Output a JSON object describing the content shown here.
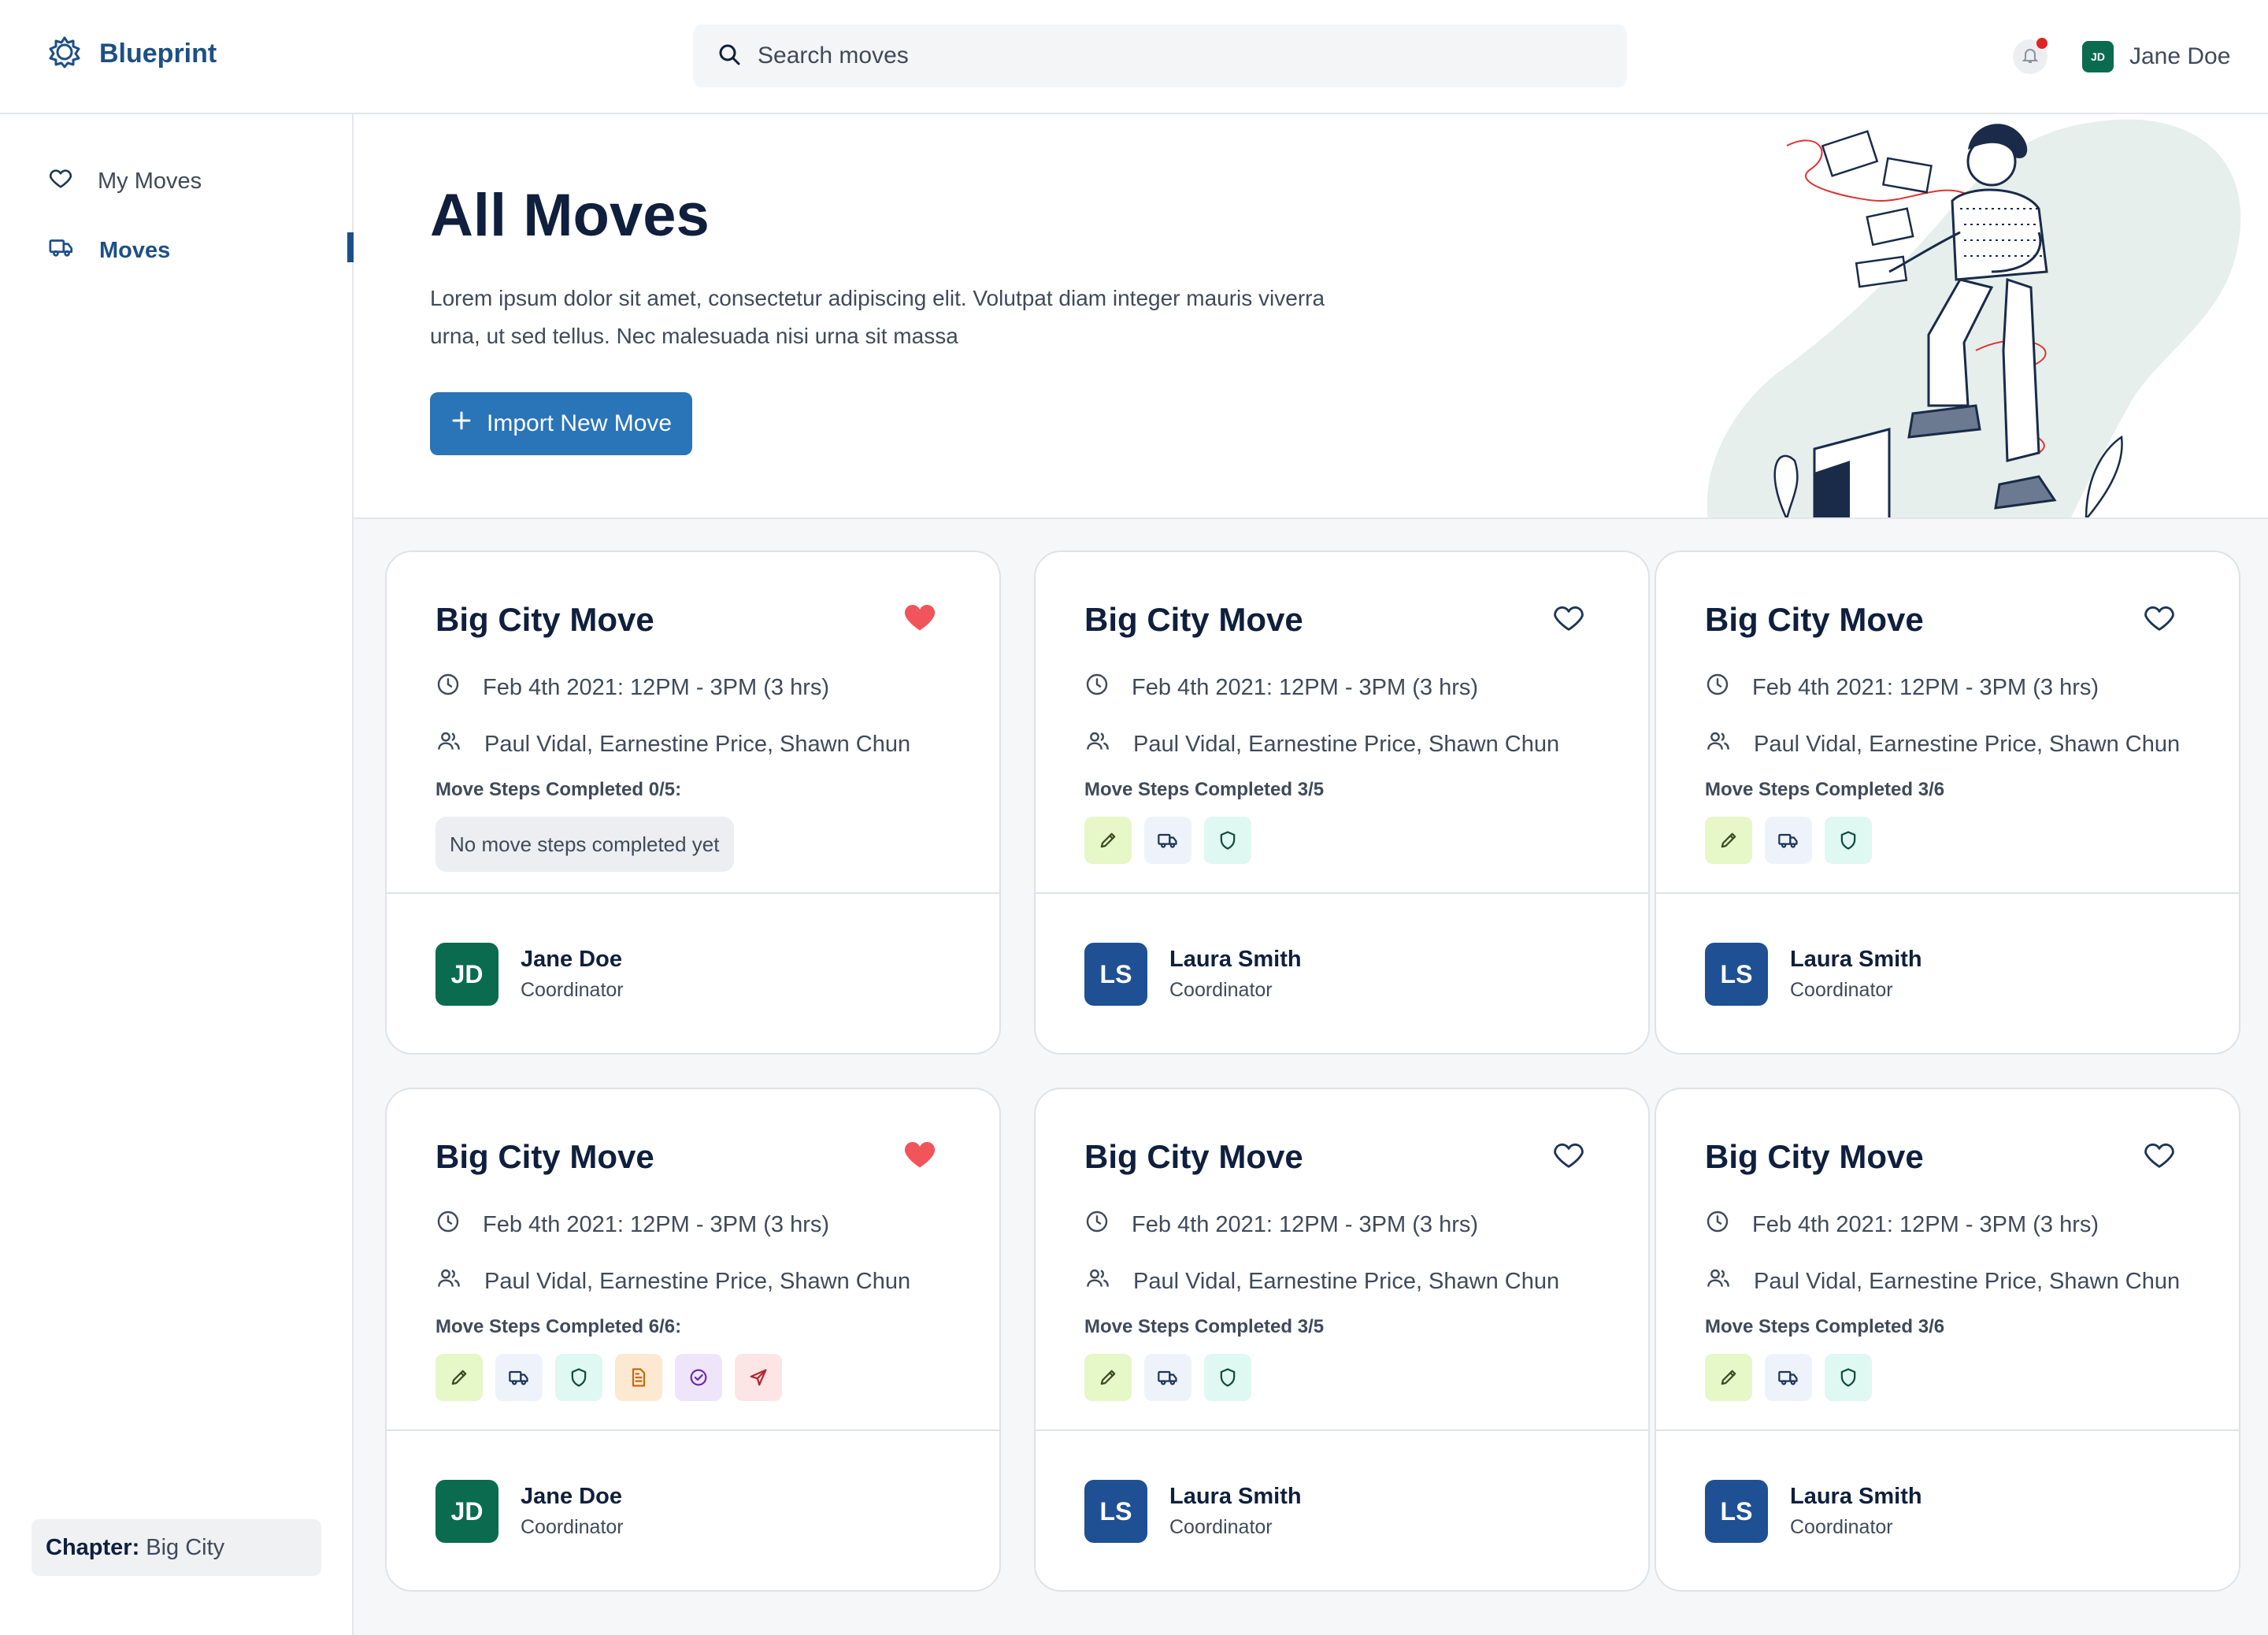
{
  "brand": {
    "name": "Blueprint"
  },
  "search": {
    "placeholder": "Search moves"
  },
  "user": {
    "name": "Jane Doe",
    "initials": "JD"
  },
  "sidebar": {
    "items": [
      {
        "label": "My Moves",
        "icon": "heart-icon"
      },
      {
        "label": "Moves",
        "icon": "truck-icon",
        "active": true
      }
    ],
    "chapter_label": "Chapter:",
    "chapter_value": "Big City"
  },
  "hero": {
    "title": "All Moves",
    "description": "Lorem ipsum dolor sit amet, consectetur adipiscing elit. Volutpat diam integer mauris viverra urna, ut sed tellus. Nec malesuada nisi urna sit massa",
    "button_label": "Import New Move"
  },
  "colors": {
    "brand": "#1d4f86",
    "primary_button": "#2a74b8",
    "favorite": "#f2545b",
    "avatar_jd": "#0a6b4f",
    "avatar_ls": "#1f5094"
  },
  "cards": [
    {
      "title": "Big City Move",
      "favorite": true,
      "time": "Feb 4th 2021: 12PM - 3PM (3 hrs)",
      "people": "Paul Vidal, Earnestine Price, Shawn Chun",
      "steps_label": "Move Steps Completed 0/5:",
      "steps": [],
      "empty_text": "No move steps completed yet",
      "coordinator": {
        "initials": "JD",
        "name": "Jane Doe",
        "role": "Coordinator"
      }
    },
    {
      "title": "Big City Move",
      "favorite": false,
      "time": "Feb 4th 2021: 12PM - 3PM (3 hrs)",
      "people": "Paul Vidal, Earnestine Price, Shawn Chun",
      "steps_label": "Move Steps Completed 3/5",
      "steps": [
        "pencil-icon",
        "truck-icon",
        "shield-icon"
      ],
      "empty_text": "",
      "coordinator": {
        "initials": "LS",
        "name": "Laura Smith",
        "role": "Coordinator"
      }
    },
    {
      "title": "Big City Move",
      "favorite": false,
      "time": "Feb 4th 2021: 12PM - 3PM (3 hrs)",
      "people": "Paul Vidal, Earnestine Price, Shawn Chun",
      "steps_label": "Move Steps Completed 3/6",
      "steps": [
        "pencil-icon",
        "truck-icon",
        "shield-icon"
      ],
      "empty_text": "",
      "coordinator": {
        "initials": "LS",
        "name": "Laura Smith",
        "role": "Coordinator"
      }
    },
    {
      "title": "Big City Move",
      "favorite": true,
      "time": "Feb 4th 2021: 12PM - 3PM (3 hrs)",
      "people": "Paul Vidal, Earnestine Price, Shawn Chun",
      "steps_label": "Move Steps Completed 6/6:",
      "steps": [
        "pencil-icon",
        "truck-icon",
        "shield-icon",
        "document-icon",
        "check-circle-icon",
        "send-icon"
      ],
      "empty_text": "",
      "coordinator": {
        "initials": "JD",
        "name": "Jane Doe",
        "role": "Coordinator"
      }
    },
    {
      "title": "Big City Move",
      "favorite": false,
      "time": "Feb 4th 2021: 12PM - 3PM (3 hrs)",
      "people": "Paul Vidal, Earnestine Price, Shawn Chun",
      "steps_label": "Move Steps Completed 3/5",
      "steps": [
        "pencil-icon",
        "truck-icon",
        "shield-icon"
      ],
      "empty_text": "",
      "coordinator": {
        "initials": "LS",
        "name": "Laura Smith",
        "role": "Coordinator"
      }
    },
    {
      "title": "Big City Move",
      "favorite": false,
      "time": "Feb 4th 2021: 12PM - 3PM (3 hrs)",
      "people": "Paul Vidal, Earnestine Price, Shawn Chun",
      "steps_label": "Move Steps Completed 3/6",
      "steps": [
        "pencil-icon",
        "truck-icon",
        "shield-icon"
      ],
      "empty_text": "",
      "coordinator": {
        "initials": "LS",
        "name": "Laura Smith",
        "role": "Coordinator"
      }
    }
  ]
}
